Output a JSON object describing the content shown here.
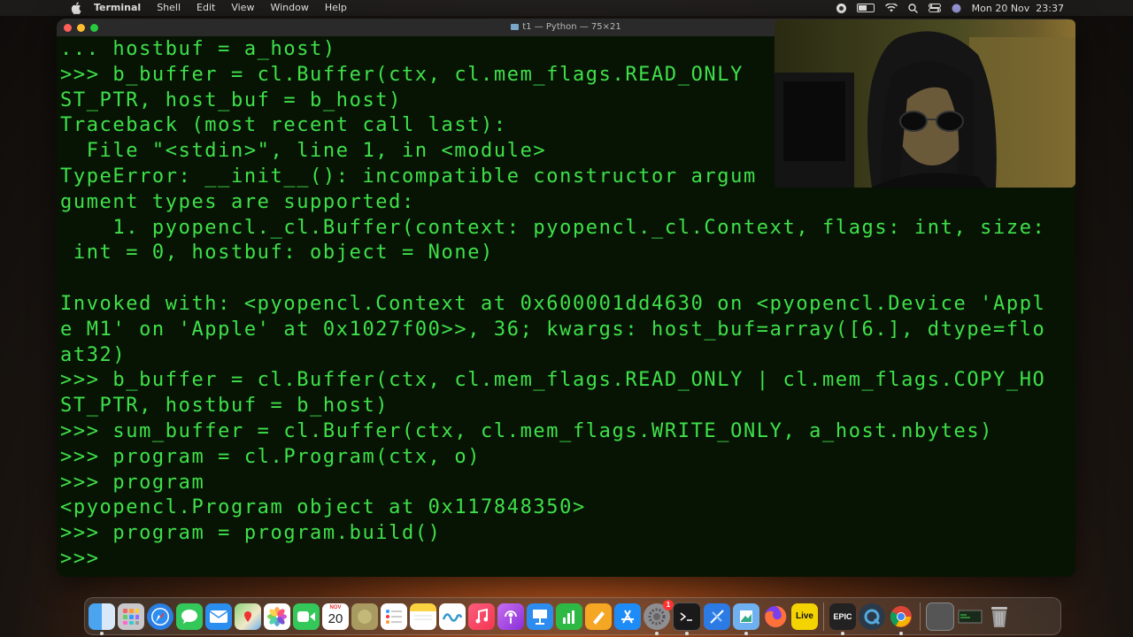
{
  "menubar": {
    "app_name": "Terminal",
    "menus": [
      "Shell",
      "Edit",
      "View",
      "Window",
      "Help"
    ],
    "datetime": "Mon 20 Nov  23:37"
  },
  "window": {
    "title": "t1 — Python — 75×21"
  },
  "terminal": {
    "lines": [
      "... hostbuf = a_host)",
      ">>> b_buffer = cl.Buffer(ctx, cl.mem_flags.READ_ONLY",
      "ST_PTR, host_buf = b_host)",
      "Traceback (most recent call last):",
      "  File \"<stdin>\", line 1, in <module>",
      "TypeError: __init__(): incompatible constructor argum",
      "gument types are supported:",
      "    1. pyopencl._cl.Buffer(context: pyopencl._cl.Context, flags: int, size:",
      " int = 0, hostbuf: object = None)",
      "",
      "Invoked with: <pyopencl.Context at 0x600001dd4630 on <pyopencl.Device 'Appl",
      "e M1' on 'Apple' at 0x1027f00>>, 36; kwargs: host_buf=array([6.], dtype=flo",
      "at32)",
      ">>> b_buffer = cl.Buffer(ctx, cl.mem_flags.READ_ONLY | cl.mem_flags.COPY_HO",
      "ST_PTR, hostbuf = b_host)",
      ">>> sum_buffer = cl.Buffer(ctx, cl.mem_flags.WRITE_ONLY, a_host.nbytes)",
      ">>> program = cl.Program(ctx, o)",
      ">>> program",
      "<pyopencl.Program object at 0x117848350>",
      ">>> program = program.build()",
      ">>> "
    ]
  },
  "dock": {
    "calendar_month": "NOV",
    "calendar_day": "20",
    "epic_label": "EPIC",
    "live_label": "Live",
    "badge": "1",
    "items": [
      "finder-icon",
      "launchpad-icon",
      "safari-icon",
      "messages-icon",
      "mail-icon",
      "maps-icon",
      "photos-icon",
      "facetime-icon",
      "calendar-icon",
      "finder-alt-icon",
      "reminders-icon",
      "notes-icon",
      "freeform-icon",
      "music-icon",
      "podcasts-icon",
      "keynote-icon",
      "numbers-icon",
      "pages-icon",
      "app-store-icon",
      "system-settings-icon",
      "terminal-icon",
      "xcode-icon",
      "preview-icon",
      "firefox-icon",
      "ableton-live-icon",
      "epic-games-icon",
      "quicktime-icon",
      "chrome-icon",
      "folder-icon",
      "screen-icon",
      "trash-icon"
    ]
  },
  "colors": {
    "terminal_bg": "#071404",
    "terminal_text": "#3fe04a"
  }
}
